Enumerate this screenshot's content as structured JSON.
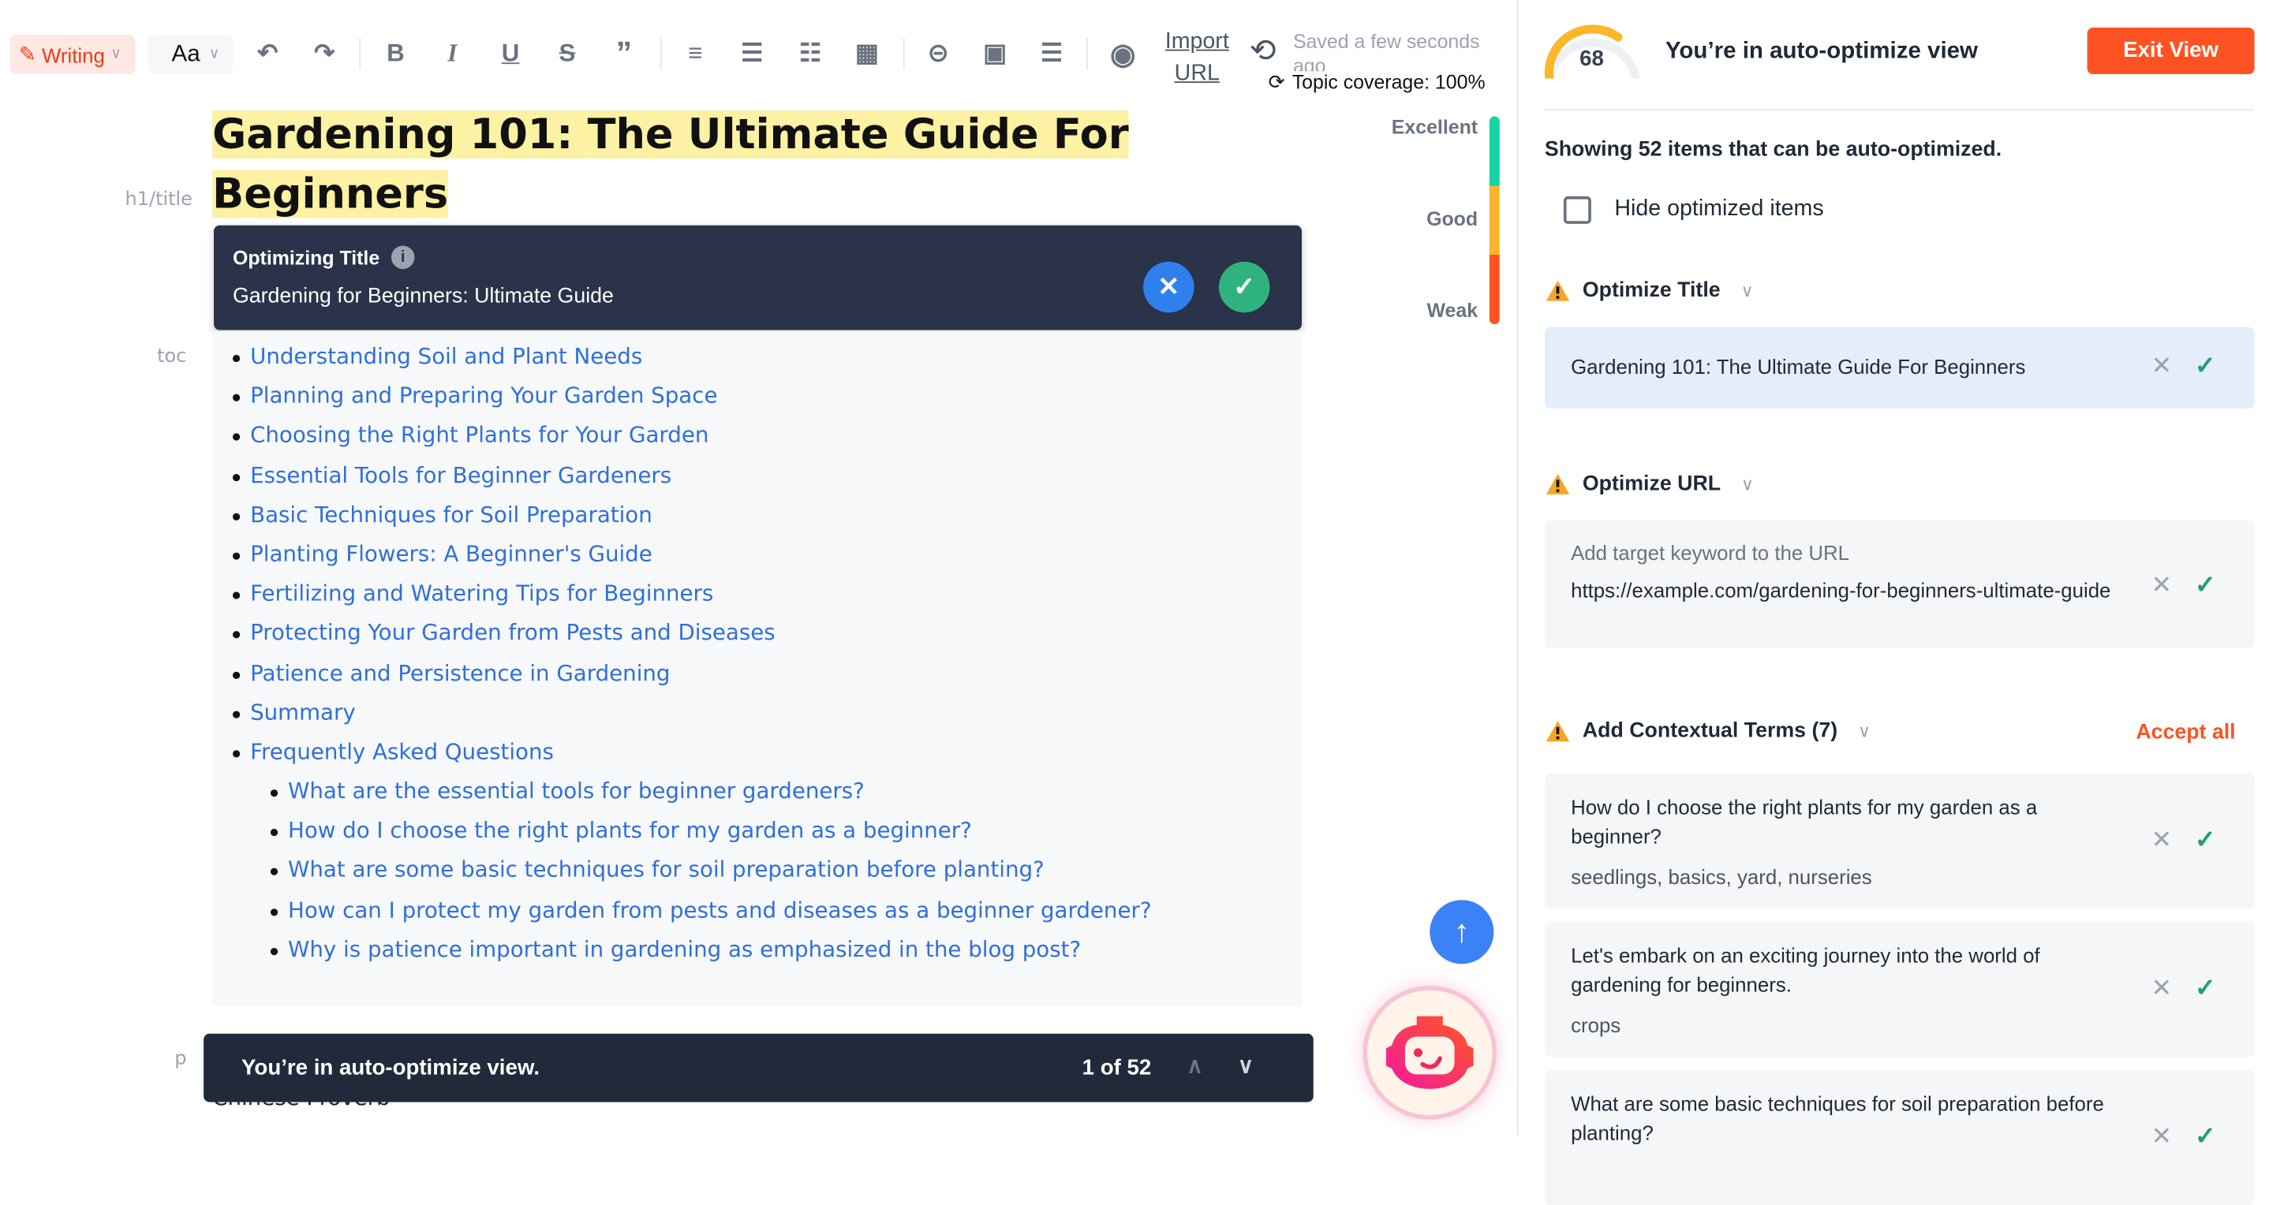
{
  "toolbar": {
    "mode": "Writing",
    "font": "Aa",
    "import_url": [
      "Import",
      "URL"
    ],
    "saved": "Saved a few seconds ago",
    "topic_coverage": "Topic coverage: 100%",
    "icons": [
      "undo-icon",
      "redo-icon",
      "bold-icon",
      "italic-icon",
      "underline-icon",
      "strikethrough-icon",
      "quote-icon",
      "align-icon",
      "bullet-list-icon",
      "numbered-list-icon",
      "table-icon",
      "link-icon",
      "image-icon",
      "more-icon",
      "preview-icon"
    ]
  },
  "editor": {
    "title": "Gardening 101: The Ultimate Guide For Beginners",
    "labels": {
      "h1": "h1/title",
      "toc": "toc",
      "p": "p"
    },
    "popup": {
      "heading": "Optimizing Title",
      "suggestion": "Gardening for Beginners: Ultimate Guide"
    },
    "toc": [
      "Understanding Soil and Plant Needs",
      "Planning and Preparing Your Garden Space",
      "Choosing the Right Plants for Your Garden",
      "Essential Tools for Beginner Gardeners",
      "Basic Techniques for Soil Preparation",
      "Planting Flowers: A Beginner's Guide",
      "Fertilizing and Watering Tips for Beginners",
      "Protecting Your Garden from Pests and Diseases",
      "Patience and Persistence in Gardening",
      "Summary",
      "Frequently Asked Questions"
    ],
    "faq": [
      "What are the essential tools for beginner gardeners?",
      "How do I choose the right plants for my garden as a beginner?",
      "What are some basic techniques for soil preparation before planting?",
      "How can I protect my garden from pests and diseases as a beginner gardener?",
      "Why is patience important in gardening as emphasized in the blog post?"
    ],
    "hidden_text": "Chinese Proverb",
    "bottom_bar": {
      "message": "You’re in auto-optimize view.",
      "counter": "1 of 52"
    }
  },
  "score_bar": {
    "levels": [
      "Excellent",
      "Good",
      "Weak"
    ],
    "colors": [
      "#16d3a3",
      "#fbb62b",
      "#ff5222"
    ]
  },
  "panel": {
    "score": 68,
    "score_max": 100,
    "heading": "You’re in auto-optimize view",
    "exit": "Exit View",
    "showing": "Showing 52 items that can be auto-optimized.",
    "hide_label": "Hide optimized items",
    "hide_checked": false,
    "title_section": {
      "heading": "Optimize Title",
      "value": "Gardening 101: The Ultimate Guide For Beginners"
    },
    "url_section": {
      "heading": "Optimize URL",
      "hint": "Add target keyword to the URL",
      "value": "https://example.com/gardening-for-beginners-ultimate-guide"
    },
    "terms_section": {
      "heading": "Add Contextual Terms (7)",
      "accept_all": "Accept all",
      "items": [
        {
          "text": "How do I choose the right plants for my garden as a beginner?",
          "terms": "seedlings, basics, yard, nurseries"
        },
        {
          "text": "Let's embark on an exciting journey into the world of gardening for beginners.",
          "terms": "crops"
        },
        {
          "text": "What are some basic techniques for soil preparation before planting?",
          "terms": ""
        }
      ]
    }
  },
  "colors": {
    "accent": "#ff5222",
    "link": "#2f6fdc",
    "dark": "#212a3b"
  }
}
